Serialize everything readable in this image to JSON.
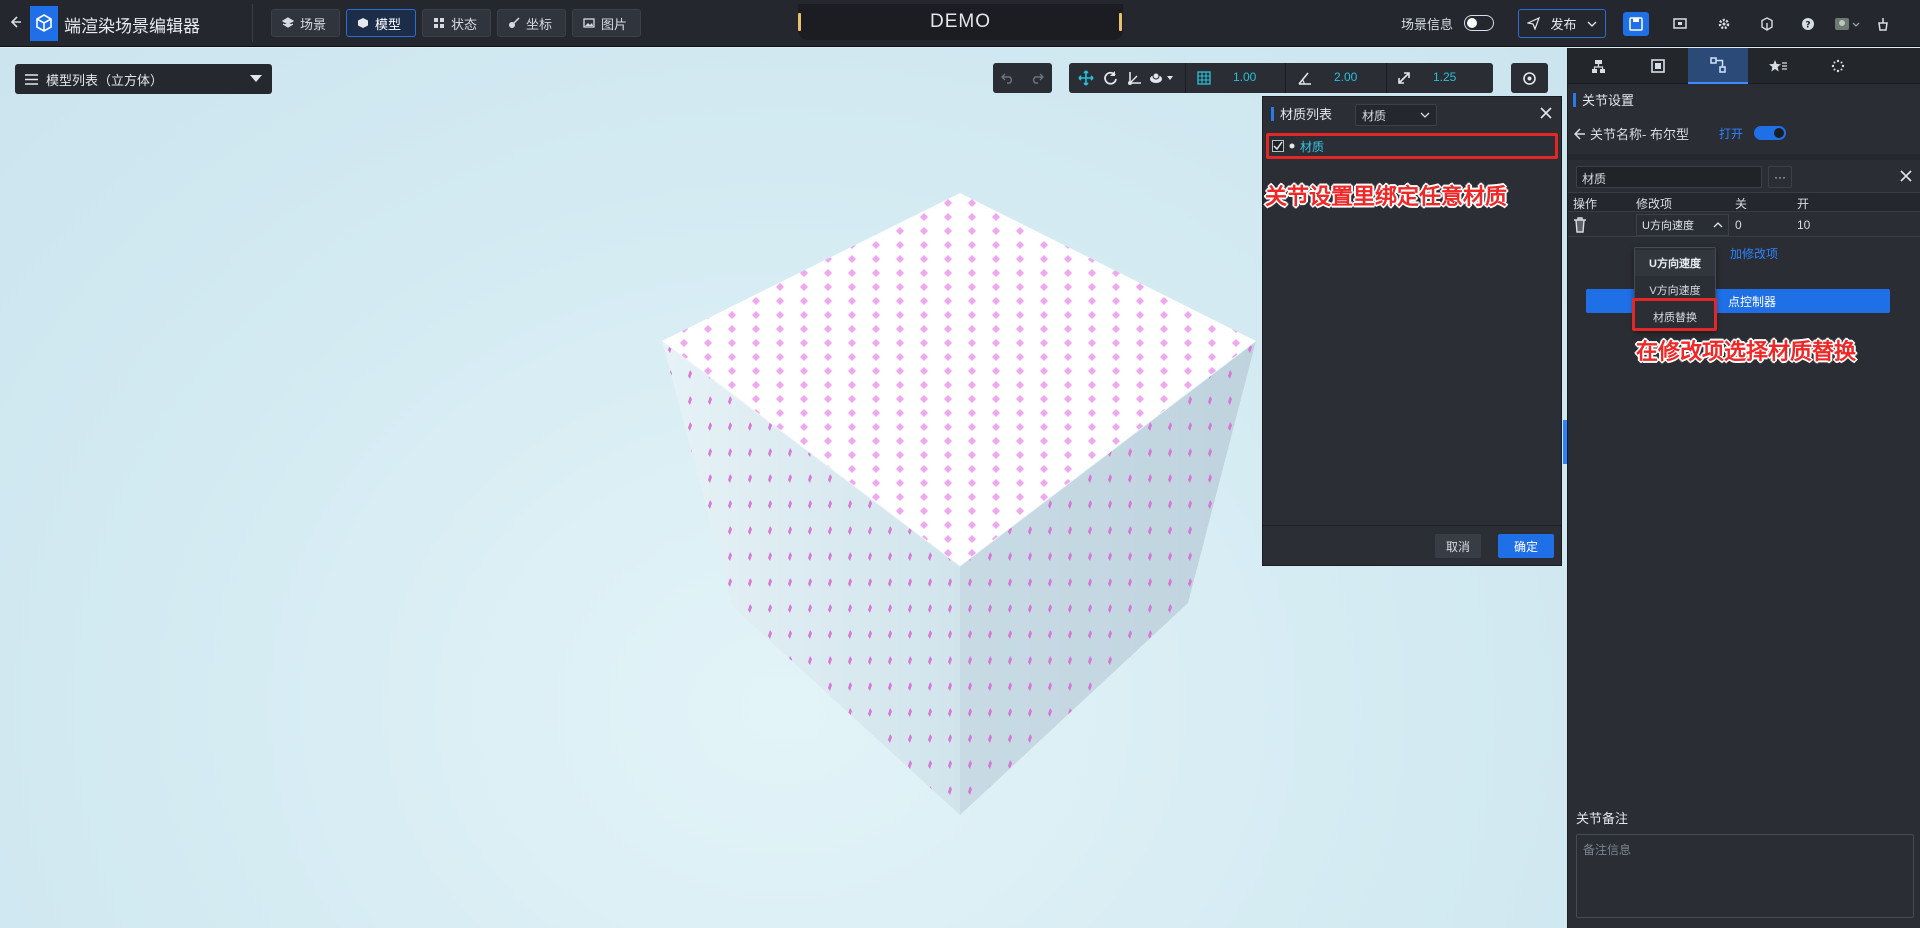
{
  "app": {
    "title": "端渲染场景编辑器"
  },
  "tabs": {
    "scene": "场景",
    "model": "模型",
    "state": "状态",
    "coord": "坐标",
    "image": "图片"
  },
  "demo_label": "DEMO",
  "topbar": {
    "scene_info": "场景信息",
    "publish": "发布"
  },
  "model_list": {
    "label": "模型列表（立方体）"
  },
  "transform": {
    "grid_snap": "1.00",
    "angle_snap": "2.00",
    "scale_snap": "1.25"
  },
  "material_panel": {
    "title": "材质列表",
    "filter": "材质",
    "item": "材质",
    "annotation": "关节设置里绑定任意材质",
    "cancel": "取消",
    "ok": "确定"
  },
  "right_panel": {
    "section_title": "关节设置",
    "joint_name": "关节名称- 布尔型",
    "open_label": "打开",
    "material_field": "材质",
    "more": "···",
    "table_headers": {
      "op": "操作",
      "mod": "修改项",
      "off": "关",
      "on": "开"
    },
    "row": {
      "mod": "U方向速度",
      "off": "0",
      "on": "10"
    },
    "add_mod": "加修改项",
    "add_ctrl": "点控制器",
    "dropdown": [
      "U方向速度",
      "V方向速度",
      "材质替换"
    ],
    "annotation": "在修改项选择材质替换",
    "notes_label": "关节备注",
    "notes_placeholder": "备注信息"
  },
  "colors": {
    "accent": "#1f6fe6",
    "annotation_red": "#e22727",
    "cube_dots": "#e58ae8"
  }
}
